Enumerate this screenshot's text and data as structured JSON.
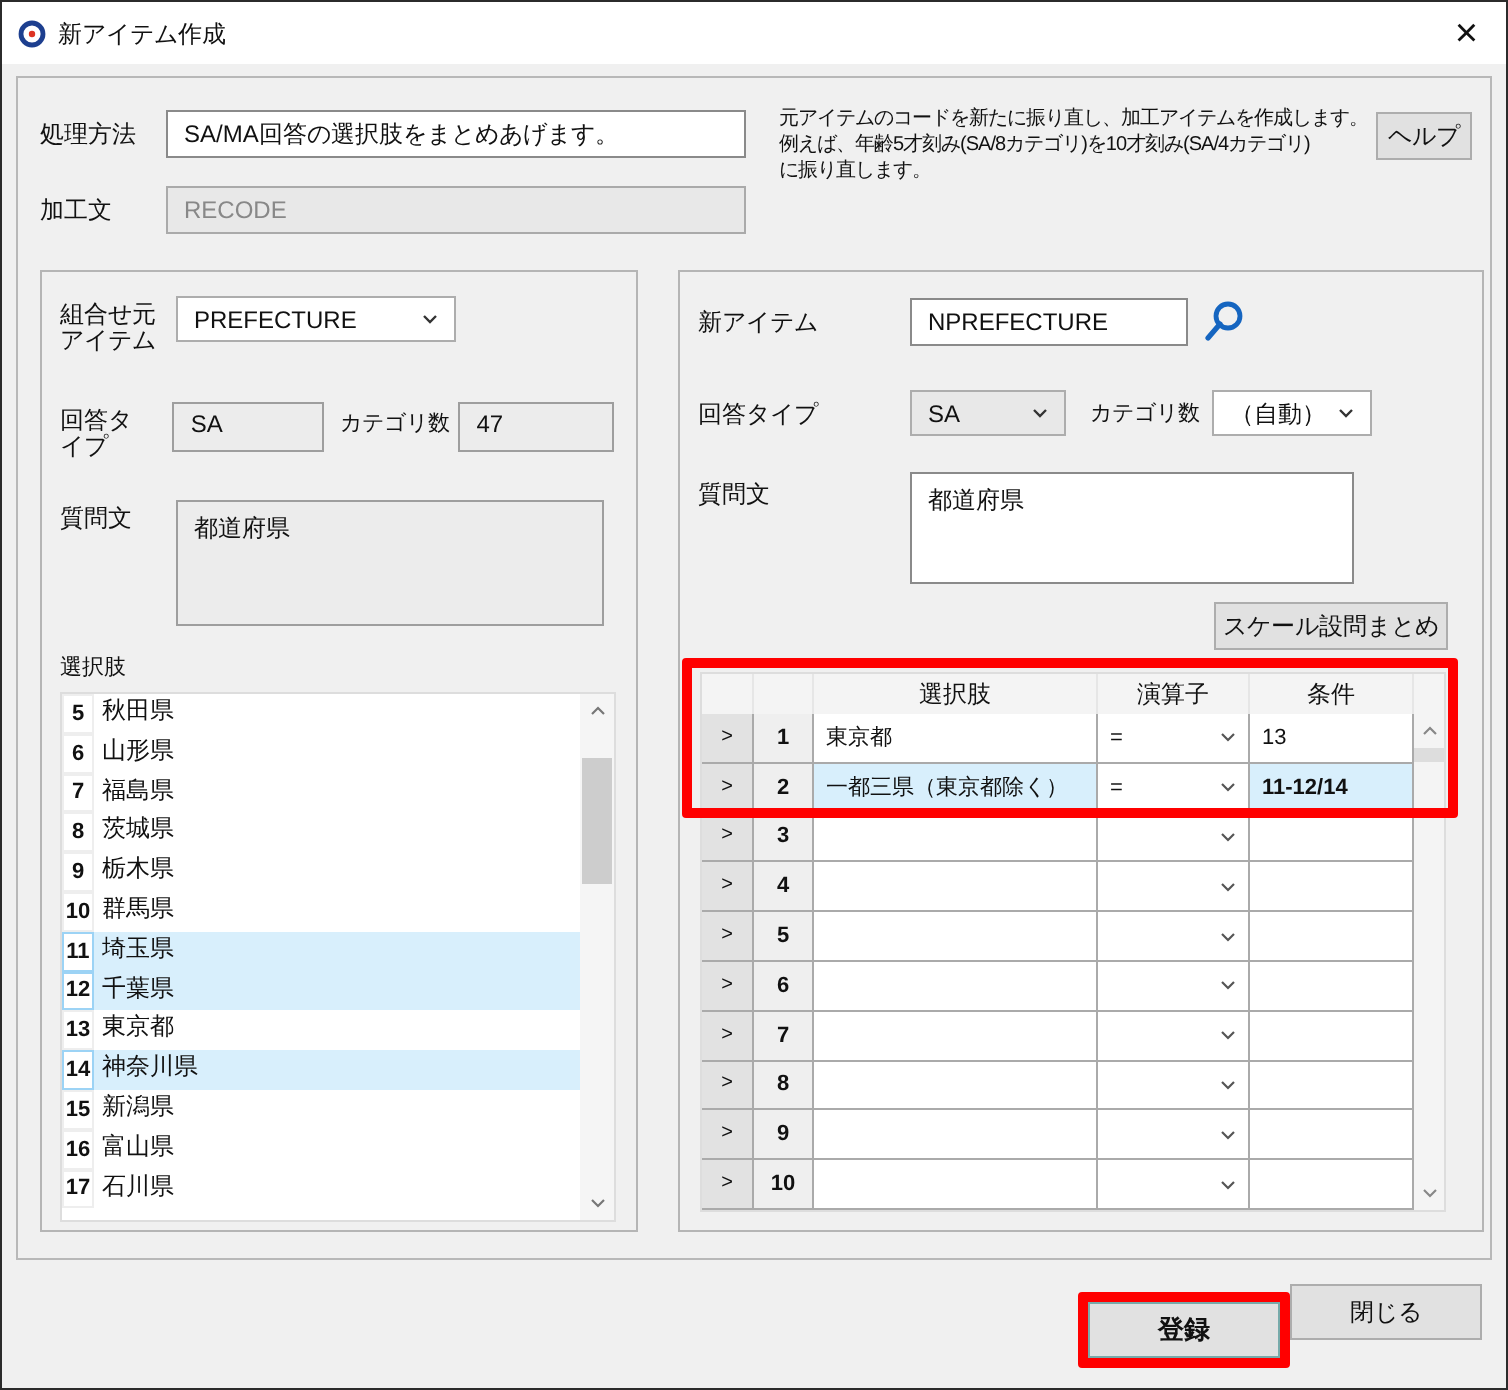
{
  "window": {
    "title": "新アイテム作成",
    "close": "×"
  },
  "method": {
    "label": "処理方法",
    "value": "SA/MA回答の選択肢をまとめあげます。",
    "description": [
      "元アイテムのコードを新たに振り直し、加工アイテムを作成します。",
      "例えば、年齢5才刻み(SA/8カテゴリ)を10才刻み(SA/4カテゴリ)",
      "に振り直します。"
    ],
    "help_button": "ヘルプ"
  },
  "process_text": {
    "label": "加工文",
    "value": "RECODE",
    "disabled": true
  },
  "source": {
    "item_label": "組合せ元アイテム",
    "item_value": "PREFECTURE",
    "answer_type_label": "回答タイプ",
    "answer_type": "SA",
    "category_count_label": "カテゴリ数",
    "category_count": "47",
    "question_label": "質問文",
    "question": "都道府県",
    "choices_label": "選択肢",
    "choices": [
      {
        "no": "5",
        "text": "秋田県",
        "selected": false
      },
      {
        "no": "6",
        "text": "山形県",
        "selected": false
      },
      {
        "no": "7",
        "text": "福島県",
        "selected": false
      },
      {
        "no": "8",
        "text": "茨城県",
        "selected": false
      },
      {
        "no": "9",
        "text": "栃木県",
        "selected": false
      },
      {
        "no": "10",
        "text": "群馬県",
        "selected": false
      },
      {
        "no": "11",
        "text": "埼玉県",
        "selected": true
      },
      {
        "no": "12",
        "text": "千葉県",
        "selected": true
      },
      {
        "no": "13",
        "text": "東京都",
        "selected": false
      },
      {
        "no": "14",
        "text": "神奈川県",
        "selected": true
      },
      {
        "no": "15",
        "text": "新潟県",
        "selected": false
      },
      {
        "no": "16",
        "text": "富山県",
        "selected": false
      },
      {
        "no": "17",
        "text": "石川県",
        "selected": false
      }
    ]
  },
  "target": {
    "item_label": "新アイテム",
    "item_value": "NPREFECTURE",
    "answer_type_label": "回答タイプ",
    "answer_type": "SA",
    "category_count_label": "カテゴリ数",
    "category_count": "（自動）",
    "question_label": "質問文",
    "question": "都道府県",
    "scale_button": "スケール設問まとめ"
  },
  "grid": {
    "highlighted": true,
    "columns": [
      "選択肢",
      "演算子",
      "条件"
    ],
    "rows": [
      {
        "arrow": ">",
        "no": "1",
        "choice": "東京都",
        "operator": "=",
        "condition": "13",
        "selected": false
      },
      {
        "arrow": ">",
        "no": "2",
        "choice": "一都三県（東京都除く）",
        "operator": "=",
        "condition": "11-12/14",
        "selected": true
      },
      {
        "arrow": ">",
        "no": "3",
        "selected": false
      },
      {
        "arrow": ">",
        "no": "4",
        "selected": false
      },
      {
        "arrow": ">",
        "no": "5",
        "selected": false
      },
      {
        "arrow": ">",
        "no": "6",
        "selected": false
      },
      {
        "arrow": ">",
        "no": "7",
        "selected": false
      },
      {
        "arrow": ">",
        "no": "8",
        "selected": false
      },
      {
        "arrow": ">",
        "no": "9",
        "selected": false
      },
      {
        "arrow": ">",
        "no": "10",
        "selected": false
      }
    ]
  },
  "buttons": [
    {
      "label": "登録",
      "kind": "primary",
      "highlighted": true
    },
    {
      "label": "閉じる",
      "kind": "normal",
      "highlighted": false
    }
  ]
}
